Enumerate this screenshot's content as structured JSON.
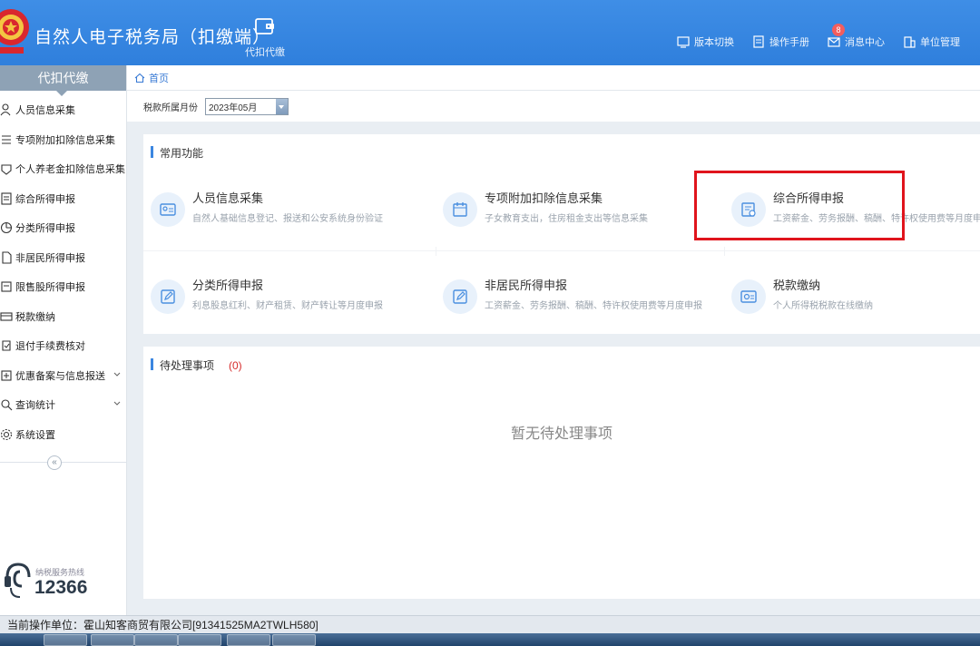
{
  "header": {
    "app_title": "自然人电子税务局（扣缴端）",
    "module_tab": "代扣代缴",
    "links": [
      {
        "label": "版本切换",
        "icon": "switch-icon"
      },
      {
        "label": "操作手册",
        "icon": "manual-icon"
      },
      {
        "label": "消息中心",
        "icon": "mail-icon",
        "badge": "8"
      },
      {
        "label": "单位管理",
        "icon": "building-icon"
      }
    ]
  },
  "sidebar": {
    "title": "代扣代缴",
    "items": [
      {
        "label": "人员信息采集"
      },
      {
        "label": "专项附加扣除信息采集"
      },
      {
        "label": "个人养老金扣除信息采集"
      },
      {
        "label": "综合所得申报"
      },
      {
        "label": "分类所得申报"
      },
      {
        "label": "非居民所得申报"
      },
      {
        "label": "限售股所得申报"
      },
      {
        "label": "税款缴纳"
      },
      {
        "label": "退付手续费核对"
      },
      {
        "label": "优惠备案与信息报送"
      },
      {
        "label": "查询统计"
      },
      {
        "label": "系统设置"
      }
    ],
    "collapse_label": "«",
    "hotline_caption": "纳税服务热线",
    "hotline_number": "12366"
  },
  "main": {
    "breadcrumb": "首页",
    "month_label": "税款所属月份",
    "month_value": "2023年05月",
    "common_title": "常用功能",
    "cards": [
      {
        "title": "人员信息采集",
        "desc": "自然人基础信息登记、报送和公安系统身份验证"
      },
      {
        "title": "专项附加扣除信息采集",
        "desc": "子女教育支出，住房租金支出等信息采集"
      },
      {
        "title": "综合所得申报",
        "desc": "工资薪金、劳务报酬、稿酬、特许权使用费等月度申报"
      },
      {
        "title": "分类所得申报",
        "desc": "利息股息红利、财产租赁、财产转让等月度申报"
      },
      {
        "title": "非居民所得申报",
        "desc": "工资薪金、劳务报酬、稿酬、特许权使用费等月度申报"
      },
      {
        "title": "税款缴纳",
        "desc": "个人所得税税款在线缴纳"
      }
    ],
    "pending_title": "待处理事项",
    "pending_count": "(0)",
    "pending_empty": "暂无待处理事项"
  },
  "statusbar": {
    "text": "当前操作单位：霍山知客商贸有限公司[91341525MA2TWLH580]"
  },
  "colors": {
    "header_blue": "#3a88e2",
    "accent": "#3b86e0",
    "highlight_red": "#e0141c"
  }
}
